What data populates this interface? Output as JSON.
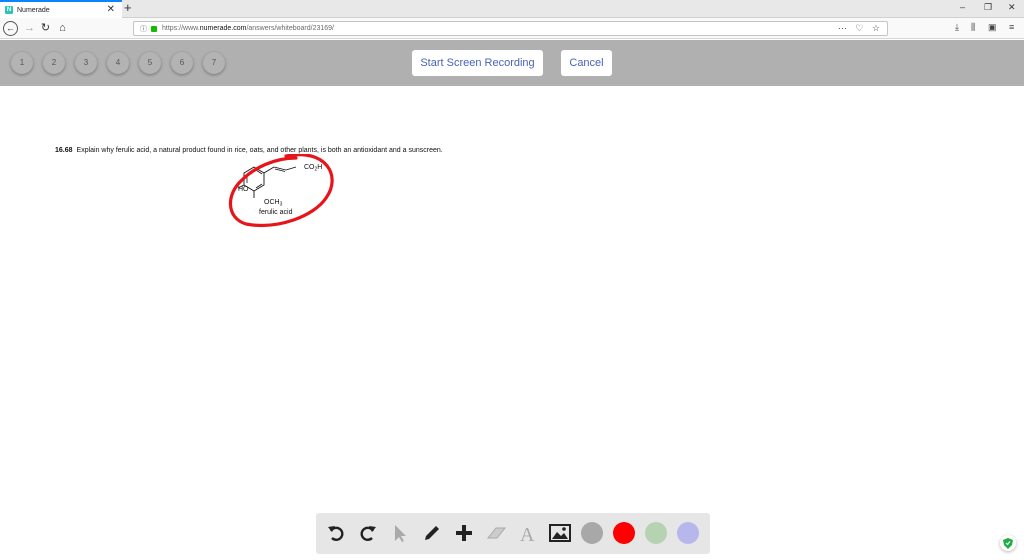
{
  "browser": {
    "tab_title": "Numerade",
    "favicon_letter": "N",
    "url_prefix": "https://www.",
    "url_domain": "numerade.com",
    "url_path": "/answers/whiteboard/23169/"
  },
  "recording_bar": {
    "pages": [
      "1",
      "2",
      "3",
      "4",
      "5",
      "6",
      "7"
    ],
    "start_label": "Start Screen Recording",
    "cancel_label": "Cancel"
  },
  "content": {
    "question_number": "16.68",
    "question_text": "Explain why ferulic acid, a natural product found in rice, oats, and other plants, is both an antioxidant and a sunscreen.",
    "molecule": {
      "ho_label": "HO",
      "och3_label": "OCH",
      "och3_sub": "3",
      "co2h_label": "CO",
      "co2h_sub": "2",
      "co2h_tail": "H",
      "name": "ferulic acid"
    },
    "annotation_color": "#e8141b"
  },
  "toolbar": {
    "tools": [
      "undo-icon",
      "redo-icon",
      "pointer-icon",
      "pencil-icon",
      "plus-icon",
      "eraser-icon",
      "text-icon",
      "image-icon"
    ],
    "colors": [
      "#a8a8a8",
      "#ff0000",
      "#b5d3b0",
      "#b7b7ec"
    ]
  }
}
